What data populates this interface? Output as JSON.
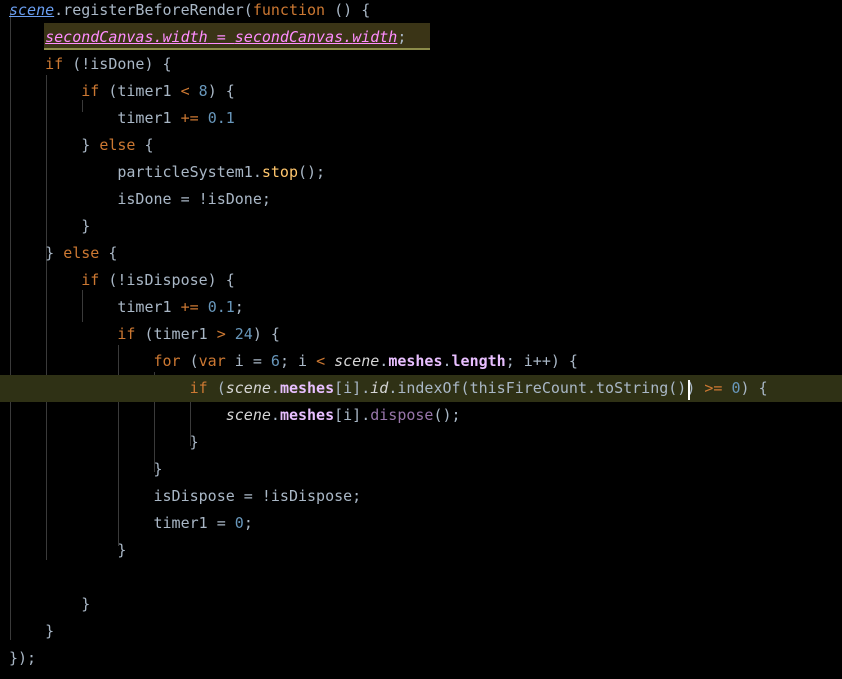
{
  "editor": {
    "colors": {
      "background": "#000000",
      "keyword": "#cc7832",
      "number": "#6897bb",
      "property": "#9876aa",
      "default": "#a9b7c6",
      "current_line": "#2f3115"
    },
    "lines": [
      [
        {
          "t": "scene",
          "c": "t-scene"
        },
        {
          "t": ".registerBeforeRender(",
          "c": "t-fn"
        },
        {
          "t": "function",
          "c": "t-kw"
        },
        {
          "t": " () {",
          "c": "t-punc"
        }
      ],
      [
        {
          "t": "    "
        },
        {
          "t": "secondCanvas",
          "c": "t-canvas"
        },
        {
          "t": ".",
          "c": "t-canvas"
        },
        {
          "t": "width",
          "c": "t-canvas"
        },
        {
          "t": " = ",
          "c": "t-canvas"
        },
        {
          "t": "secondCanvas",
          "c": "t-canvas"
        },
        {
          "t": ".",
          "c": "t-canvas"
        },
        {
          "t": "width",
          "c": "t-canvas"
        },
        {
          "t": ";",
          "c": "t-punc"
        }
      ],
      [
        {
          "t": "    "
        },
        {
          "t": "if",
          "c": "t-kw"
        },
        {
          "t": " (!isDone) {",
          "c": "t-punc"
        }
      ],
      [
        {
          "t": "        "
        },
        {
          "t": "if",
          "c": "t-kw"
        },
        {
          "t": " (timer1 ",
          "c": "t-punc"
        },
        {
          "t": "<",
          "c": "t-op"
        },
        {
          "t": " ",
          "c": "t-punc"
        },
        {
          "t": "8",
          "c": "t-num"
        },
        {
          "t": ") {",
          "c": "t-punc"
        }
      ],
      [
        {
          "t": "            "
        },
        {
          "t": "timer1 ",
          "c": "t-id"
        },
        {
          "t": "+=",
          "c": "t-op"
        },
        {
          "t": " ",
          "c": "t-punc"
        },
        {
          "t": "0.1",
          "c": "t-num"
        }
      ],
      [
        {
          "t": "        "
        },
        {
          "t": "} ",
          "c": "t-punc"
        },
        {
          "t": "else",
          "c": "t-kw"
        },
        {
          "t": " {",
          "c": "t-punc"
        }
      ],
      [
        {
          "t": "            "
        },
        {
          "t": "particleSystem1.",
          "c": "t-id"
        },
        {
          "t": "stop",
          "c": "t-method"
        },
        {
          "t": "();",
          "c": "t-punc"
        }
      ],
      [
        {
          "t": "            "
        },
        {
          "t": "isDone = !isDone;",
          "c": "t-id"
        }
      ],
      [
        {
          "t": "        "
        },
        {
          "t": "}",
          "c": "t-punc"
        }
      ],
      [
        {
          "t": "    "
        },
        {
          "t": "} ",
          "c": "t-punc"
        },
        {
          "t": "else",
          "c": "t-kw"
        },
        {
          "t": " {",
          "c": "t-punc"
        }
      ],
      [
        {
          "t": "        "
        },
        {
          "t": "if",
          "c": "t-kw"
        },
        {
          "t": " (!isDispose) {",
          "c": "t-punc"
        }
      ],
      [
        {
          "t": "            "
        },
        {
          "t": "timer1 ",
          "c": "t-id"
        },
        {
          "t": "+=",
          "c": "t-op"
        },
        {
          "t": " ",
          "c": "t-punc"
        },
        {
          "t": "0.1",
          "c": "t-num"
        },
        {
          "t": ";",
          "c": "t-punc"
        }
      ],
      [
        {
          "t": "            "
        },
        {
          "t": "if",
          "c": "t-kw"
        },
        {
          "t": " (timer1 ",
          "c": "t-punc"
        },
        {
          "t": ">",
          "c": "t-op"
        },
        {
          "t": " ",
          "c": "t-punc"
        },
        {
          "t": "24",
          "c": "t-num"
        },
        {
          "t": ") {",
          "c": "t-punc"
        }
      ],
      [
        {
          "t": "                "
        },
        {
          "t": "for",
          "c": "t-kw"
        },
        {
          "t": " (",
          "c": "t-punc"
        },
        {
          "t": "var",
          "c": "t-kw"
        },
        {
          "t": " i = ",
          "c": "t-id"
        },
        {
          "t": "6",
          "c": "t-num"
        },
        {
          "t": "; i ",
          "c": "t-punc"
        },
        {
          "t": "<",
          "c": "t-op"
        },
        {
          "t": " ",
          "c": "t-punc"
        },
        {
          "t": "scene",
          "c": "t-scene2"
        },
        {
          "t": ".",
          "c": "t-punc"
        },
        {
          "t": "meshes",
          "c": "t-bold-prop"
        },
        {
          "t": ".",
          "c": "t-punc"
        },
        {
          "t": "length",
          "c": "t-bold-prop"
        },
        {
          "t": "; i++) {",
          "c": "t-punc"
        }
      ],
      [
        {
          "t": "                    "
        },
        {
          "t": "if",
          "c": "t-kw"
        },
        {
          "t": " (",
          "c": "t-punc"
        },
        {
          "t": "scene",
          "c": "t-scene2"
        },
        {
          "t": ".",
          "c": "t-punc"
        },
        {
          "t": "meshes",
          "c": "t-bold-prop"
        },
        {
          "t": "[i].",
          "c": "t-punc"
        },
        {
          "t": "id",
          "c": "t-scene2"
        },
        {
          "t": ".",
          "c": "t-punc"
        },
        {
          "t": "indexOf(thisFireCount.",
          "c": "t-id"
        },
        {
          "t": "toString",
          "c": "t-id"
        },
        {
          "t": "()) ",
          "c": "t-punc"
        },
        {
          "t": ">=",
          "c": "t-op"
        },
        {
          "t": " ",
          "c": "t-punc"
        },
        {
          "t": "0",
          "c": "t-num"
        },
        {
          "t": ") {",
          "c": "t-punc"
        }
      ],
      [
        {
          "t": "                        "
        },
        {
          "t": "scene",
          "c": "t-scene2"
        },
        {
          "t": ".",
          "c": "t-punc"
        },
        {
          "t": "meshes",
          "c": "t-bold-prop"
        },
        {
          "t": "[i].",
          "c": "t-punc"
        },
        {
          "t": "dispose",
          "c": "t-prop"
        },
        {
          "t": "();",
          "c": "t-punc"
        }
      ],
      [
        {
          "t": "                    "
        },
        {
          "t": "}",
          "c": "t-punc"
        }
      ],
      [
        {
          "t": "                "
        },
        {
          "t": "}",
          "c": "t-punc"
        }
      ],
      [
        {
          "t": "                "
        },
        {
          "t": "isDispose = !isDispose;",
          "c": "t-id"
        }
      ],
      [
        {
          "t": "                "
        },
        {
          "t": "timer1 = ",
          "c": "t-id"
        },
        {
          "t": "0",
          "c": "t-num"
        },
        {
          "t": ";",
          "c": "t-punc"
        }
      ],
      [
        {
          "t": "            "
        },
        {
          "t": "}",
          "c": "t-punc"
        }
      ],
      [
        {
          "t": ""
        }
      ],
      [
        {
          "t": "        "
        },
        {
          "t": "}",
          "c": "t-punc"
        }
      ],
      [
        {
          "t": "    "
        },
        {
          "t": "}",
          "c": "t-punc"
        }
      ],
      [
        {
          "t": "});",
          "c": "t-punc"
        }
      ]
    ]
  }
}
